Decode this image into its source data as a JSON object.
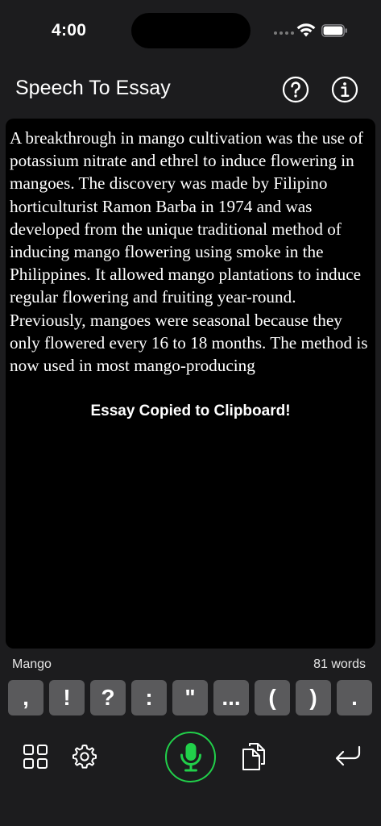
{
  "status": {
    "time": "4:00"
  },
  "header": {
    "title": "Speech To Essay"
  },
  "essay": {
    "text": "A breakthrough in mango cultivation was the use of potassium nitrate and ethrel to induce flowering in mangoes. The discovery was made by Filipino horticulturist Ramon Barba in 1974 and was developed from the unique traditional method of inducing mango flowering using smoke in the Philippines. It allowed mango plantations to induce regular flowering and fruiting year-round. Previously, mangoes were seasonal because they only flowered every 16 to 18 months. The method is now used in most mango-producing",
    "toast": "Essay Copied to Clipboard!"
  },
  "info": {
    "topic": "Mango",
    "word_count": "81 words"
  },
  "punctuation": [
    ",",
    "!",
    "?",
    ":",
    "\"",
    "...",
    "(",
    ")",
    "."
  ],
  "icons": {
    "help": "question-circle-icon",
    "info": "info-circle-icon",
    "grid": "grid-icon",
    "settings": "gear-icon",
    "mic": "microphone-icon",
    "copy": "copy-icon",
    "return": "return-icon"
  },
  "colors": {
    "background": "#1c1c1e",
    "essay_bg": "#000000",
    "key_bg": "#5a5a5c",
    "mic_accent": "#21d04a"
  }
}
